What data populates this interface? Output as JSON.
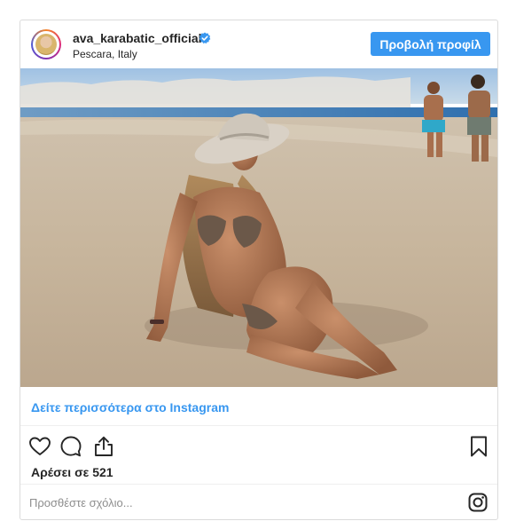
{
  "post": {
    "username": "ava_karabatic_official",
    "location": "Pescara, Italy",
    "verified": true,
    "profile_button_label": "Προβολή προφίλ",
    "see_more_label": "Δείτε περισσότερα στο Instagram",
    "likes_text": "Αρέσει σε 521",
    "comment_placeholder": "Προσθέστε σχόλιο..."
  },
  "icons": [
    "verified-badge-icon",
    "heart-icon",
    "comment-icon",
    "share-icon",
    "bookmark-icon",
    "instagram-logo-icon"
  ],
  "colors": {
    "accent": "#3897f0",
    "border": "#dbdbdb",
    "text": "#262626",
    "placeholder": "#8e8e8e"
  }
}
